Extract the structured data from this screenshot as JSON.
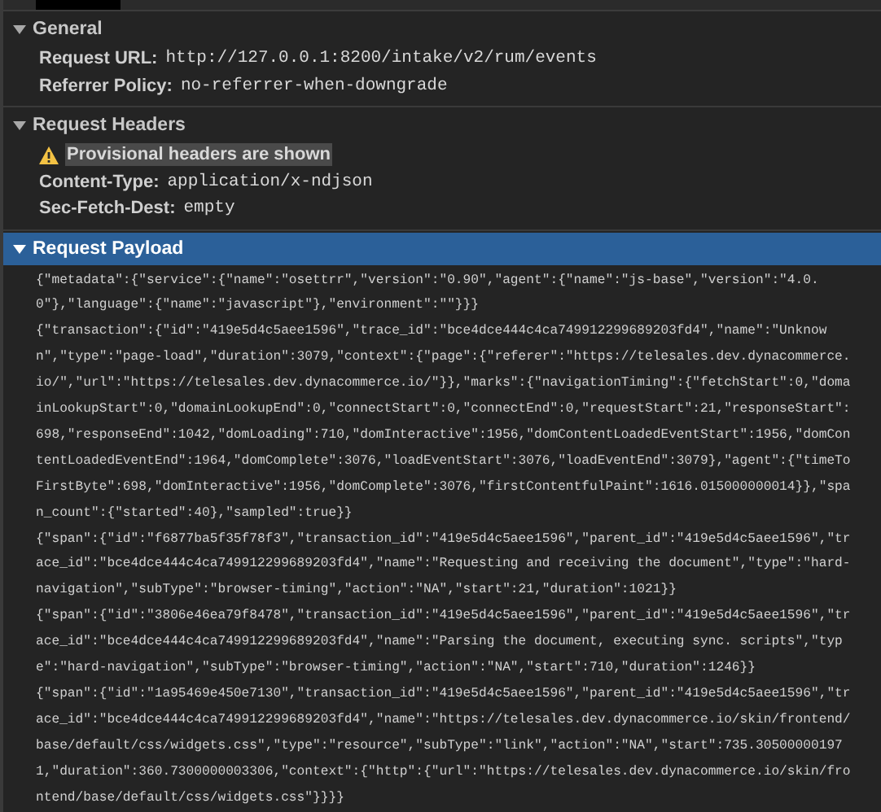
{
  "sections": [
    {
      "title": "General",
      "expanded": true,
      "selected": false,
      "kind": "headers",
      "rows": [
        {
          "kind": "field",
          "label": "Request URL:",
          "value": "http://127.0.0.1:8200/intake/v2/rum/events"
        },
        {
          "kind": "field",
          "label": "Referrer Policy:",
          "value": "no-referrer-when-downgrade"
        }
      ]
    },
    {
      "title": "Request Headers",
      "expanded": true,
      "selected": false,
      "kind": "headers",
      "rows": [
        {
          "kind": "warning",
          "label": "Provisional headers are shown"
        },
        {
          "kind": "field",
          "label": "Content-Type:",
          "value": "application/x-ndjson"
        },
        {
          "kind": "field",
          "label": "Sec-Fetch-Dest:",
          "value": "empty"
        }
      ]
    },
    {
      "title": "Request Payload",
      "expanded": true,
      "selected": true,
      "kind": "payload",
      "records": [
        {
          "lines": [
            "{\"metadata\":{\"service\":{\"name\":\"osettrr\",\"version\":\"0.90\",\"agent\":{\"name\":\"js-base\",\"version\":\"4.0.",
            "0\"},\"language\":{\"name\":\"javascript\"},\"environment\":\"\"}}}"
          ]
        },
        {
          "lines": [
            "{\"transaction\":{\"id\":\"419e5d4c5aee1596\",\"trace_id\":\"bce4dce444c4ca749912299689203fd4\",\"name\":\"Unknow",
            "n\",\"type\":\"page-load\",\"duration\":3079,\"context\":{\"page\":{\"referer\":\"https://telesales.dev.dynacommerce.",
            "io/\",\"url\":\"https://telesales.dev.dynacommerce.io/\"}},\"marks\":{\"navigationTiming\":{\"fetchStart\":0,\"doma",
            "inLookupStart\":0,\"domainLookupEnd\":0,\"connectStart\":0,\"connectEnd\":0,\"requestStart\":21,\"responseStart\":",
            "698,\"responseEnd\":1042,\"domLoading\":710,\"domInteractive\":1956,\"domContentLoadedEventStart\":1956,\"domCon",
            "tentLoadedEventEnd\":1964,\"domComplete\":3076,\"loadEventStart\":3076,\"loadEventEnd\":3079},\"agent\":{\"timeTo",
            "FirstByte\":698,\"domInteractive\":1956,\"domComplete\":3076,\"firstContentfulPaint\":1616.015000000014}},\"spa",
            "n_count\":{\"started\":40},\"sampled\":true}}"
          ]
        },
        {
          "lines": [
            "{\"span\":{\"id\":\"f6877ba5f35f78f3\",\"transaction_id\":\"419e5d4c5aee1596\",\"parent_id\":\"419e5d4c5aee1596\",\"tr",
            "ace_id\":\"bce4dce444c4ca749912299689203fd4\",\"name\":\"Requesting and receiving the document\",\"type\":\"hard-",
            "navigation\",\"subType\":\"browser-timing\",\"action\":\"NA\",\"start\":21,\"duration\":1021}}"
          ]
        },
        {
          "lines": [
            "{\"span\":{\"id\":\"3806e46ea79f8478\",\"transaction_id\":\"419e5d4c5aee1596\",\"parent_id\":\"419e5d4c5aee1596\",\"tr",
            "ace_id\":\"bce4dce444c4ca749912299689203fd4\",\"name\":\"Parsing the document, executing sync. scripts\",\"typ",
            "e\":\"hard-navigation\",\"subType\":\"browser-timing\",\"action\":\"NA\",\"start\":710,\"duration\":1246}}"
          ]
        },
        {
          "lines": [
            "{\"span\":{\"id\":\"1a95469e450e7130\",\"transaction_id\":\"419e5d4c5aee1596\",\"parent_id\":\"419e5d4c5aee1596\",\"tr",
            "ace_id\":\"bce4dce444c4ca749912299689203fd4\",\"name\":\"https://telesales.dev.dynacommerce.io/skin/frontend/",
            "base/default/css/widgets.css\",\"type\":\"resource\",\"subType\":\"link\",\"action\":\"NA\",\"start\":735.30500000197",
            "1,\"duration\":360.7300000003306,\"context\":{\"http\":{\"url\":\"https://telesales.dev.dynacommerce.io/skin/fro",
            "ntend/base/default/css/widgets.css\"}}}}"
          ]
        }
      ]
    }
  ]
}
